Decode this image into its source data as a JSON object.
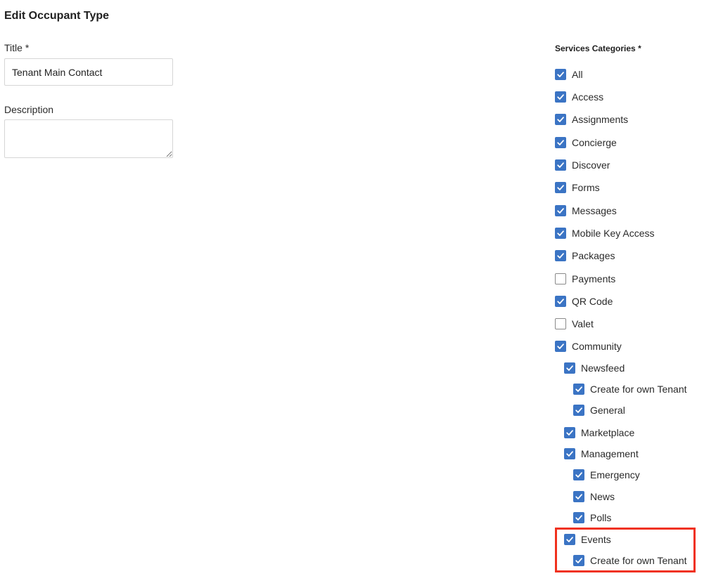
{
  "page": {
    "title": "Edit Occupant Type"
  },
  "form": {
    "title_label": "Title *",
    "title_value": "Tenant Main Contact",
    "description_label": "Description",
    "description_value": ""
  },
  "services": {
    "label": "Services Categories *",
    "items": [
      {
        "label": "All",
        "checked": true,
        "level": 0
      },
      {
        "label": "Access",
        "checked": true,
        "level": 0
      },
      {
        "label": "Assignments",
        "checked": true,
        "level": 0
      },
      {
        "label": "Concierge",
        "checked": true,
        "level": 0
      },
      {
        "label": "Discover",
        "checked": true,
        "level": 0
      },
      {
        "label": "Forms",
        "checked": true,
        "level": 0
      },
      {
        "label": "Messages",
        "checked": true,
        "level": 0
      },
      {
        "label": "Mobile Key Access",
        "checked": true,
        "level": 0
      },
      {
        "label": "Packages",
        "checked": true,
        "level": 0
      },
      {
        "label": "Payments",
        "checked": false,
        "level": 0
      },
      {
        "label": "QR Code",
        "checked": true,
        "level": 0
      },
      {
        "label": "Valet",
        "checked": false,
        "level": 0
      },
      {
        "label": "Community",
        "checked": true,
        "level": 0
      },
      {
        "label": "Newsfeed",
        "checked": true,
        "level": 1
      },
      {
        "label": "Create for own Tenant",
        "checked": true,
        "level": 2
      },
      {
        "label": "General",
        "checked": true,
        "level": 2
      },
      {
        "label": "Marketplace",
        "checked": true,
        "level": 1
      },
      {
        "label": "Management",
        "checked": true,
        "level": 1
      },
      {
        "label": "Emergency",
        "checked": true,
        "level": 2
      },
      {
        "label": "News",
        "checked": true,
        "level": 2
      },
      {
        "label": "Polls",
        "checked": true,
        "level": 2
      },
      {
        "label": "Events",
        "checked": true,
        "level": 1
      },
      {
        "label": "Create for own Tenant",
        "checked": true,
        "level": 2
      }
    ]
  },
  "colors": {
    "checkbox_checked": "#3b74c4",
    "highlight": "#f0311e"
  }
}
